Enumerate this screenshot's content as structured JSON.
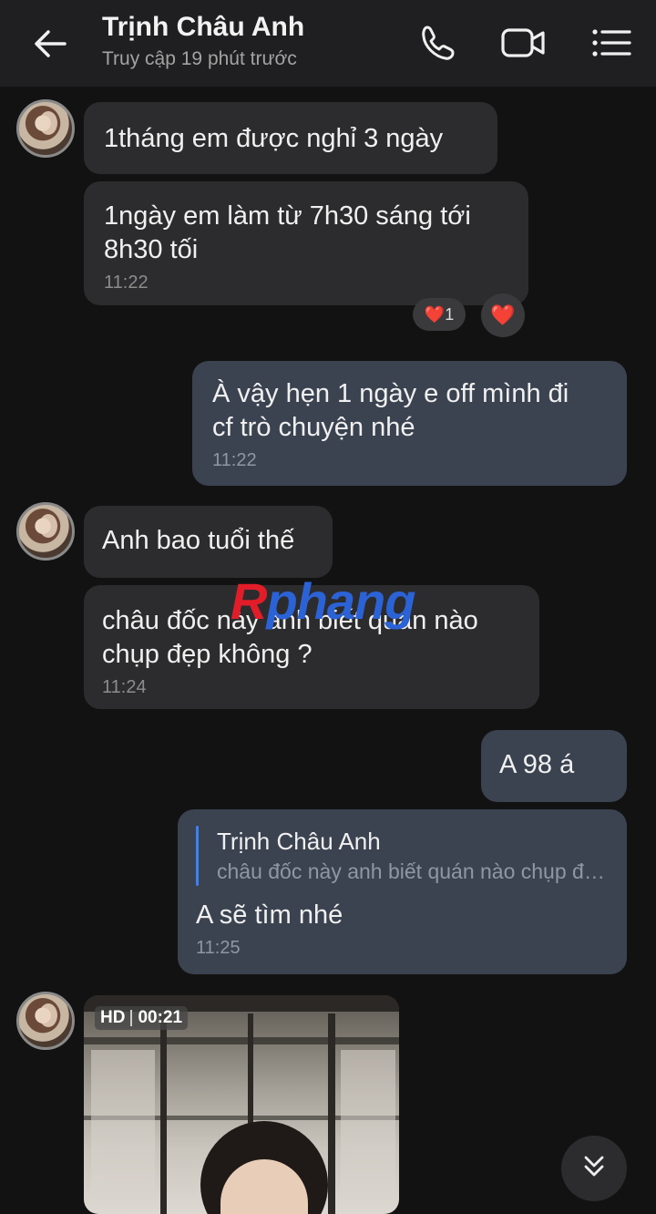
{
  "header": {
    "contact_name": "Trịnh Châu Anh",
    "status": "Truy cập 19 phút trước",
    "icons": [
      "back-arrow-icon",
      "phone-icon",
      "video-call-icon",
      "menu-list-icon"
    ]
  },
  "messages": [
    {
      "side": "in",
      "text": "1tháng em được nghỉ 3 ngày"
    },
    {
      "side": "in",
      "text": "1ngày em làm từ 7h30 sáng tới\n8h30 tối",
      "time": "11:22",
      "reactions": [
        {
          "emoji": "❤️",
          "count": "1"
        },
        {
          "emoji": "❤️"
        }
      ]
    },
    {
      "side": "out",
      "text": "À vậy hẹn 1 ngày e off mình đi\ncf trò chuyện nhé",
      "time": "11:22"
    },
    {
      "side": "in",
      "text": "Anh bao tuổi thế"
    },
    {
      "side": "in",
      "text": "châu đốc này anh biết quán nào\nchụp đẹp không ?",
      "time": "11:24"
    },
    {
      "side": "out",
      "text": "A 98 á"
    },
    {
      "side": "out",
      "quote": {
        "name": "Trịnh Châu Anh",
        "text": "châu đốc này anh biết quán nào chụp đẹp không ?"
      },
      "text": "A sẽ tìm nhé",
      "time": "11:25"
    }
  ],
  "video": {
    "quality": "HD",
    "duration": "00:21"
  },
  "watermark": {
    "part1": "R",
    "part2": "phang"
  },
  "colors": {
    "background": "#121212",
    "incoming": "#2c2c2e",
    "outgoing": "#3b4351",
    "quote_bar": "#3b82f6"
  }
}
